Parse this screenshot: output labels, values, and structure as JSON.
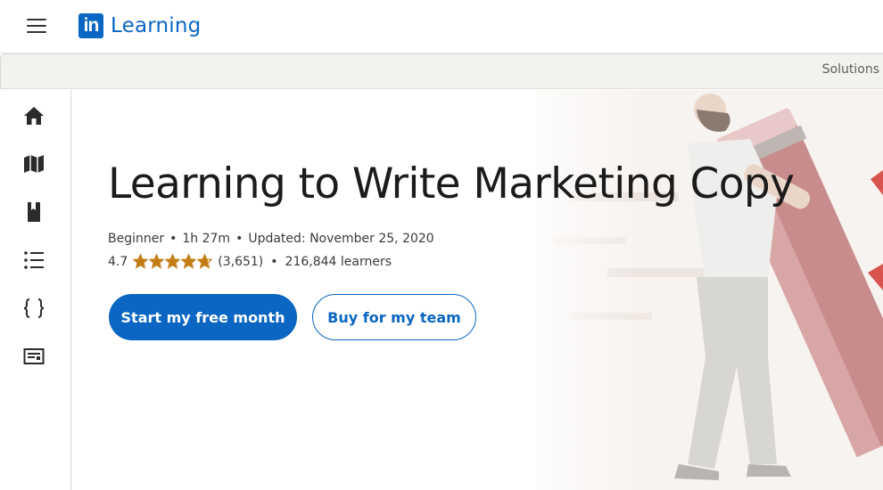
{
  "header": {
    "menu_icon": "hamburger-menu-icon",
    "brand_mark": "in",
    "brand_text": "Learning",
    "brand_color": "#0a66c2"
  },
  "subnav": {
    "solutions_label": "Solutions"
  },
  "rail": {
    "items": [
      {
        "icon": "home-icon"
      },
      {
        "icon": "map-icon"
      },
      {
        "icon": "book-icon"
      },
      {
        "icon": "list-icon"
      },
      {
        "icon": "code-braces-icon"
      },
      {
        "icon": "certificate-icon"
      }
    ]
  },
  "course": {
    "title": "Learning to Write Marketing Copy",
    "level": "Beginner",
    "duration": "1h 27m",
    "updated": "Updated: November 25, 2020",
    "rating": "4.7",
    "rating_value": 4.7,
    "rating_max": 5,
    "rating_count": "(3,651)",
    "learners": "216,844 learners",
    "star_color": "#c37d16"
  },
  "actions": {
    "primary_label": "Start my free month",
    "secondary_label": "Buy for my team"
  },
  "colors": {
    "accent": "#0a66c2",
    "subbar_bg": "#f3f2ef"
  }
}
